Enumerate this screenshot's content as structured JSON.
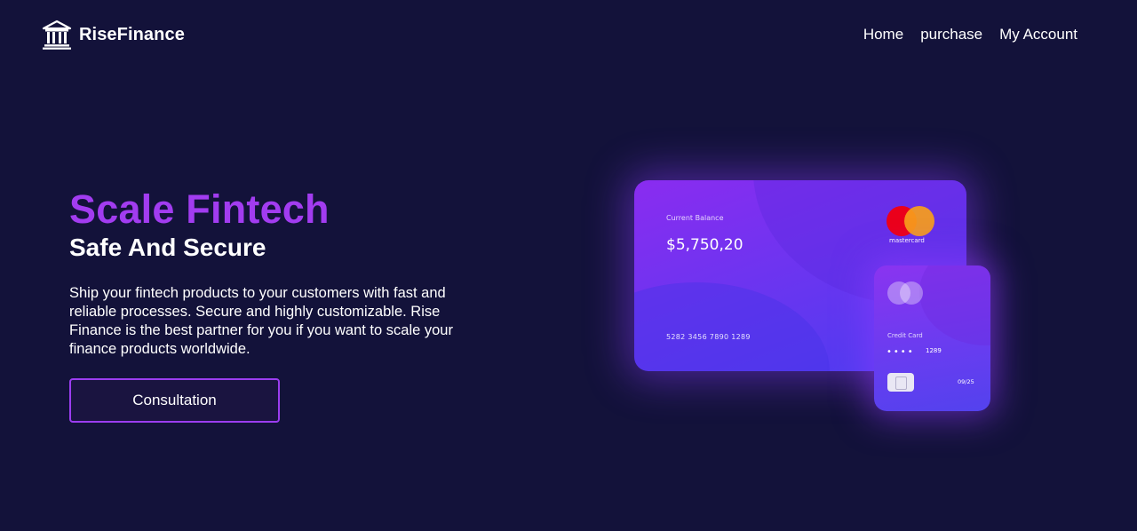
{
  "brand": {
    "name": "RiseFinance",
    "icon": "bank-icon"
  },
  "nav": {
    "items": [
      {
        "label": "Home"
      },
      {
        "label": "purchase"
      },
      {
        "label": "My Account"
      }
    ]
  },
  "hero": {
    "title": "Scale Fintech",
    "subtitle": "Safe And Secure",
    "description": "Ship your fintech products to your customers with fast and reliable processes. Secure and highly customizable. Rise Finance is the best partner for you if you want to scale your finance products worldwide.",
    "cta_label": "Consultation"
  },
  "card_main": {
    "balance_label": "Current Balance",
    "balance": "$5,750,20",
    "number": "5282 3456 7890 1289",
    "network": "mastercard"
  },
  "card_small": {
    "label": "Credit Card",
    "masked": "••••",
    "last4": "1289",
    "expiry": "09/25"
  },
  "colors": {
    "background": "#13123a",
    "accent": "#a23cf0",
    "button_border": "#9b3df0",
    "card_gradient_start": "#8a2cf0",
    "card_gradient_end": "#4b3df0"
  }
}
